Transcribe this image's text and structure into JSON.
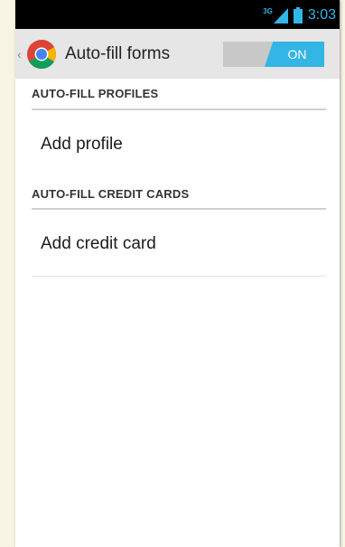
{
  "status_bar": {
    "network_type": "3G",
    "time": "3:03",
    "icons": [
      "signal-icon",
      "battery-icon"
    ],
    "accent_color": "#33b5e5"
  },
  "action_bar": {
    "up_caret": "‹",
    "app_icon": "chrome-logo-icon",
    "title": "Auto-fill forms",
    "toggle": {
      "state_label": "ON",
      "on": true,
      "color": "#33b5e5"
    }
  },
  "sections": [
    {
      "header": "AUTO-FILL PROFILES",
      "item_label": "Add profile"
    },
    {
      "header": "AUTO-FILL CREDIT CARDS",
      "item_label": "Add credit card"
    }
  ]
}
